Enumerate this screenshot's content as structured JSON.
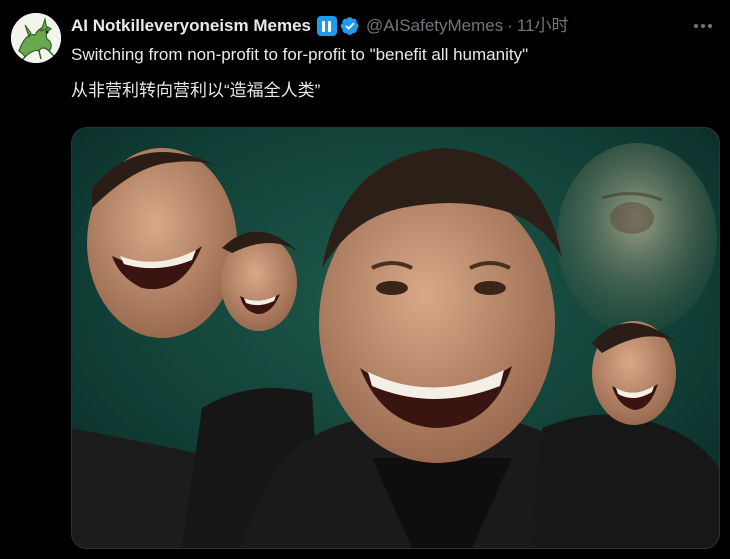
{
  "tweet": {
    "author": {
      "display_name": "AI Notkilleveryoneism Memes",
      "handle": "@AISafetyMemes",
      "avatar_icon": "green-dragon-avatar-icon",
      "badges": [
        "pause-badge-icon",
        "verified-badge-icon"
      ]
    },
    "separator": "·",
    "timestamp": "11小时",
    "text_lines": [
      "Switching from non-profit to for-profit to \"benefit all humanity\"",
      "从非营利转向营利以“造福全人类”"
    ],
    "media": {
      "kind": "image",
      "icon": "laughing-faces-collage-image"
    },
    "more_icon": "more-options-icon"
  },
  "colors": {
    "background": "#000000",
    "primary_text": "#e7e9ea",
    "secondary_text": "#71767b",
    "accent": "#1d9bf0",
    "border": "#2f3336"
  }
}
